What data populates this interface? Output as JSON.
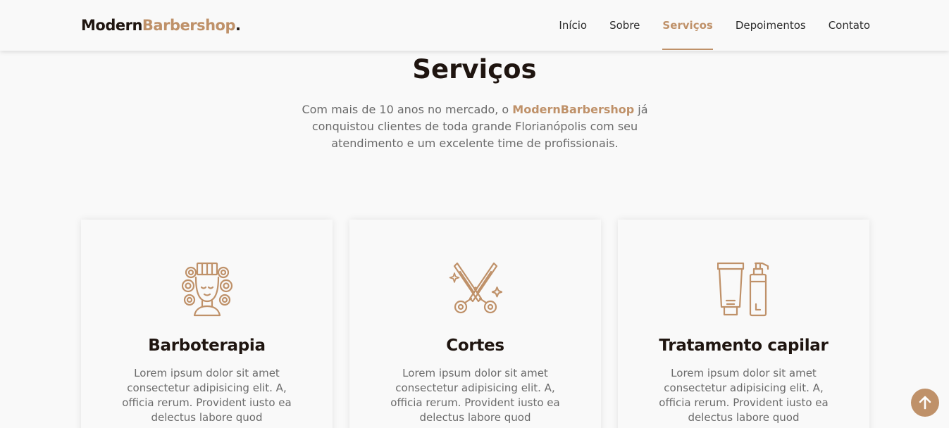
{
  "header": {
    "logo_main": "Modern",
    "logo_accent": "Barbershop",
    "logo_dot": ".",
    "nav": [
      {
        "label": "Início",
        "active": false
      },
      {
        "label": "Sobre",
        "active": false
      },
      {
        "label": "Serviços",
        "active": true
      },
      {
        "label": "Depoimentos",
        "active": false
      },
      {
        "label": "Contato",
        "active": false
      }
    ]
  },
  "section": {
    "title": "Serviços",
    "lead_before": "Com mais de 10 anos no mercado, o ",
    "lead_brand": "ModernBarbershop",
    "lead_after": " já conquistou clientes de toda grande Florianópolis com seu atendimento e um excelente time de profissionais."
  },
  "cards": [
    {
      "title": "Barboterapia",
      "icon": "hair-rollers-icon",
      "text": "Lorem ipsum dolor sit amet consectetur adipisicing elit. A, officia rerum. Provident iusto ea delectus labore quod"
    },
    {
      "title": "Cortes",
      "icon": "scissors-icon",
      "text": "Lorem ipsum dolor sit amet consectetur adipisicing elit. A, officia rerum. Provident iusto ea delectus labore quod"
    },
    {
      "title": "Tratamento capilar",
      "icon": "hair-products-icon",
      "text": "Lorem ipsum dolor sit amet consectetur adipisicing elit. A, officia rerum. Provident iusto ea delectus labore quod"
    }
  ],
  "back_to_top_icon": "arrow-up-icon",
  "colors": {
    "accent": "#bf9169",
    "heading": "#1f1510",
    "text": "#6a6a6a",
    "background": "#f9f9f9"
  }
}
